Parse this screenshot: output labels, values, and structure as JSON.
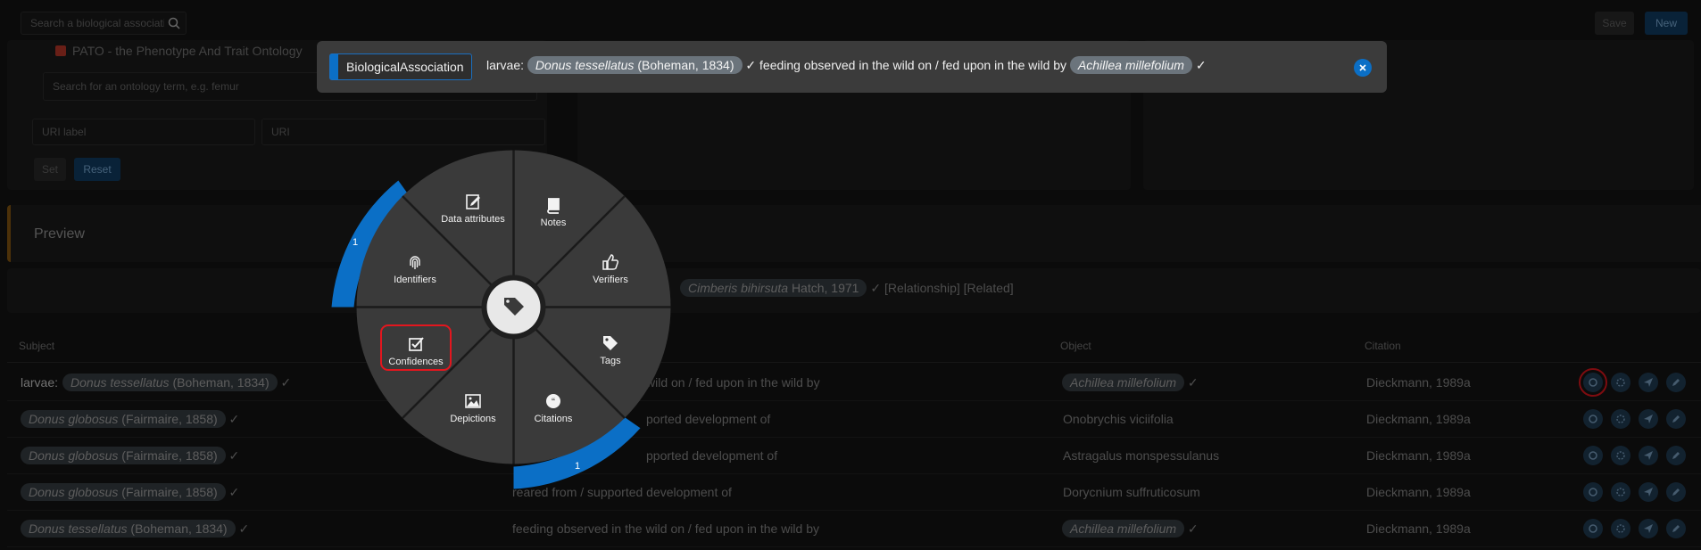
{
  "top": {
    "search_placeholder": "Search a biological associati",
    "save_label": "Save",
    "new_label": "New"
  },
  "ontology": {
    "checkbox_label": "PATO - the Phenotype And Trait Ontology",
    "search_placeholder": "Search for an ontology term, e.g. femur",
    "uri_label_placeholder": "URI label",
    "uri_placeholder": "URI",
    "set_label": "Set",
    "reset_label": "Reset"
  },
  "preview": {
    "title": "Preview",
    "object_name": "Cimberis bihirsuta",
    "object_author": "Hatch, 1971",
    "tail": "✓ [Relationship] [Related]"
  },
  "banner": {
    "type_label": "BiologicalAssociation",
    "prefix": "larvae:",
    "subject_name": "Donus tessellatus",
    "subject_author": "(Boheman, 1834)",
    "relation": "✓ feeding observed in the wild on / fed upon in the wild by",
    "object_name": "Achillea millefolium",
    "check": "✓"
  },
  "table": {
    "headers": {
      "subject": "Subject",
      "object": "Object",
      "citation": "Citation"
    },
    "rows": [
      {
        "prefix": "larvae:",
        "subject_name": "Donus tessellatus",
        "subject_author": "(Boheman, 1834)",
        "relation": "wild on / fed upon in the wild by",
        "object": "Achillea millefolium",
        "object_pill": true,
        "citation": "Dieckmann, 1989a"
      },
      {
        "prefix": "",
        "subject_name": "Donus globosus",
        "subject_author": "(Fairmaire, 1858)",
        "relation": "ported development of",
        "object": "Onobrychis viciifolia",
        "object_pill": false,
        "citation": "Dieckmann, 1989a"
      },
      {
        "prefix": "",
        "subject_name": "Donus globosus",
        "subject_author": "(Fairmaire, 1858)",
        "relation": "pported development of",
        "object": "Astragalus monspessulanus",
        "object_pill": false,
        "citation": "Dieckmann, 1989a"
      },
      {
        "prefix": "",
        "subject_name": "Donus globosus",
        "subject_author": "(Fairmaire, 1858)",
        "relation": "reared from / supported development of",
        "object": "Dorycnium suffruticosum",
        "object_pill": false,
        "citation": "Dieckmann, 1989a"
      },
      {
        "prefix": "",
        "subject_name": "Donus tessellatus",
        "subject_author": "(Boheman, 1834)",
        "relation": "feeding observed in the wild on / fed upon in the wild by",
        "object": "Achillea millefolium",
        "object_pill": true,
        "citation": "Dieckmann, 1989a"
      }
    ]
  },
  "radial_menu": {
    "data_attributes": "Data attributes",
    "notes": "Notes",
    "verifiers": "Verifiers",
    "tags": "Tags",
    "citations": "Citations",
    "depictions": "Depictions",
    "confidences": "Confidences",
    "identifiers": "Identifiers",
    "identifiers_count": "1",
    "citations_count": "1"
  },
  "colors": {
    "accent": "#0b6fc6",
    "menu_bg": "#3a3a3a",
    "highlight": "#e3161e"
  }
}
